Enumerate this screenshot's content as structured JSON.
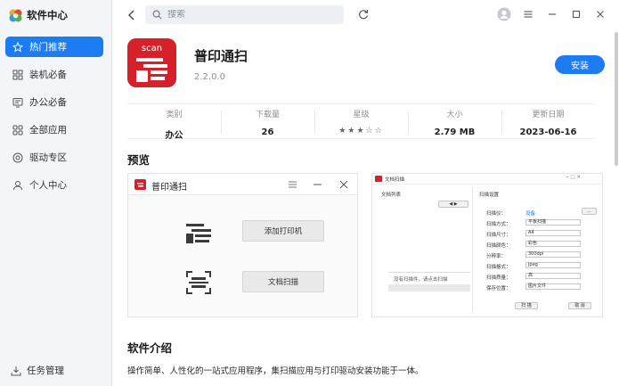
{
  "sidebar": {
    "title": "软件中心",
    "items": [
      {
        "label": "热门推荐",
        "icon": "star-icon",
        "active": true
      },
      {
        "label": "装机必备",
        "icon": "grid-icon",
        "active": false
      },
      {
        "label": "办公必备",
        "icon": "office-icon",
        "active": false
      },
      {
        "label": "全部应用",
        "icon": "apps-icon",
        "active": false
      },
      {
        "label": "驱动专区",
        "icon": "driver-icon",
        "active": false
      },
      {
        "label": "个人中心",
        "icon": "user-icon",
        "active": false
      }
    ],
    "footer": {
      "label": "任务管理",
      "icon": "download-tray-icon"
    }
  },
  "topbar": {
    "search_placeholder": "搜索"
  },
  "app": {
    "name": "普印通扫",
    "version": "2.2.0.0",
    "install_label": "安装",
    "icon_text": "scan",
    "accent": "#1d7cf2",
    "icon_color": "#d7212a"
  },
  "stats": [
    {
      "label": "类别",
      "value": "办公"
    },
    {
      "label": "下载量",
      "value": "26"
    },
    {
      "label": "星级",
      "value": "★★★☆☆",
      "rating": 3,
      "max": 5
    },
    {
      "label": "大小",
      "value": "2.79 MB"
    },
    {
      "label": "更新日期",
      "value": "2023-06-16"
    }
  ],
  "preview": {
    "title": "预览",
    "shot1": {
      "window_title": "普印通扫",
      "add_printer": "添加打印机",
      "doc_scan": "文档扫描"
    },
    "shot2": {
      "window_title": "文档扫描",
      "left_label": "文档列表",
      "right_label": "扫描设置",
      "fields": [
        "扫描仪：",
        "扫描方式：",
        "扫描尺寸：",
        "扫描颜色：",
        "分辨率：",
        "扫描格式：",
        "扫描质量：",
        "保存位置："
      ],
      "values": [
        "",
        "平板扫描",
        "A4",
        "彩色",
        "300dpi",
        "jpeg",
        "高",
        "图片文件"
      ],
      "device_link": "设备",
      "btn_scan": "扫 描",
      "btn_cancel": "取 消",
      "tip": "没有扫描件，请点击扫描"
    }
  },
  "intro": {
    "title": "软件介绍",
    "text": "操作简单、人性化的一站式应用程序，集扫描应用与打印驱动安装功能于一体。"
  }
}
